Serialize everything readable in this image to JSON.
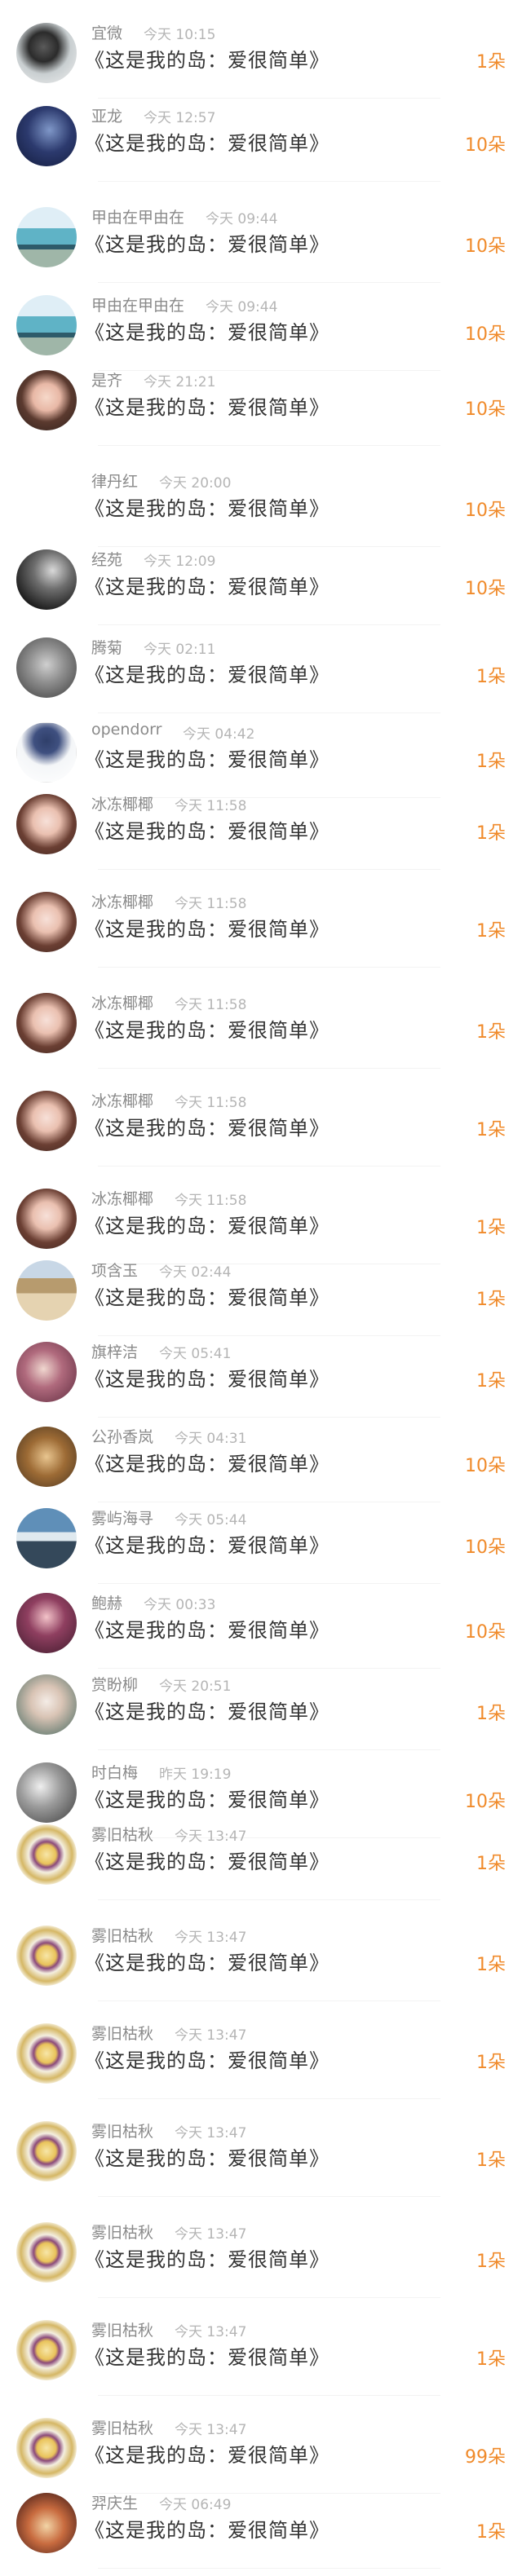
{
  "rows": [
    {
      "name": "宜微",
      "time": "今天 10:15",
      "title": "《这是我的岛：爱很简单》",
      "count": "1朵",
      "avatar": "av-ink"
    },
    {
      "name": "亚龙",
      "time": "今天 12:57",
      "title": "《这是我的岛：爱很简单》",
      "count": "10朵",
      "avatar": "av-blue"
    },
    {
      "name": "甲由在甲由在",
      "time": "今天 09:44",
      "title": "《这是我的岛：爱很简单》",
      "count": "10朵",
      "avatar": "av-van"
    },
    {
      "name": "甲由在甲由在",
      "time": "今天 09:44",
      "title": "《这是我的岛：爱很简单》",
      "count": "10朵",
      "avatar": "av-van"
    },
    {
      "name": "是齐",
      "time": "今天 21:21",
      "title": "《这是我的岛：爱很简单》",
      "count": "10朵",
      "avatar": "av-girl"
    },
    {
      "name": "律丹红",
      "time": "今天 20:00",
      "title": "《这是我的岛：爱很简单》",
      "count": "10朵",
      "avatar": ""
    },
    {
      "name": "经苑",
      "time": "今天 12:09",
      "title": "《这是我的岛：爱很简单》",
      "count": "10朵",
      "avatar": "av-dark"
    },
    {
      "name": "腾菊",
      "time": "今天 02:11",
      "title": "《这是我的岛：爱很简单》",
      "count": "1朵",
      "avatar": "av-gray"
    },
    {
      "name": "opendorr",
      "time": "今天 04:42",
      "title": "《这是我的岛：爱很简单》",
      "count": "1朵",
      "avatar": "av-sketch"
    },
    {
      "name": "冰冻椰椰",
      "time": "今天 11:58",
      "title": "《这是我的岛：爱很简单》",
      "count": "1朵",
      "avatar": "av-pink"
    },
    {
      "name": "冰冻椰椰",
      "time": "今天 11:58",
      "title": "《这是我的岛：爱很简单》",
      "count": "1朵",
      "avatar": "av-pink"
    },
    {
      "name": "冰冻椰椰",
      "time": "今天 11:58",
      "title": "《这是我的岛：爱很简单》",
      "count": "1朵",
      "avatar": "av-pink"
    },
    {
      "name": "冰冻椰椰",
      "time": "今天 11:58",
      "title": "《这是我的岛：爱很简单》",
      "count": "1朵",
      "avatar": "av-pink"
    },
    {
      "name": "冰冻椰椰",
      "time": "今天 11:58",
      "title": "《这是我的岛：爱很简单》",
      "count": "1朵",
      "avatar": "av-pink"
    },
    {
      "name": "项含玉",
      "time": "今天 02:44",
      "title": "《这是我的岛：爱很简单》",
      "count": "1朵",
      "avatar": "av-hat"
    },
    {
      "name": "旗梓洁",
      "time": "今天 05:41",
      "title": "《这是我的岛：爱很简单》",
      "count": "1朵",
      "avatar": "av-mauve"
    },
    {
      "name": "公孙香岚",
      "time": "今天 04:31",
      "title": "《这是我的岛：爱很简单》",
      "count": "10朵",
      "avatar": "av-sepia"
    },
    {
      "name": "雾屿海寻",
      "time": "今天 05:44",
      "title": "《这是我的岛：爱很简单》",
      "count": "10朵",
      "avatar": "av-sea"
    },
    {
      "name": "鲍赫",
      "time": "今天 00:33",
      "title": "《这是我的岛：爱很简单》",
      "count": "10朵",
      "avatar": "av-purple"
    },
    {
      "name": "赏盼柳",
      "time": "今天 20:51",
      "title": "《这是我的岛：爱很简单》",
      "count": "1朵",
      "avatar": "av-soft"
    },
    {
      "name": "时白梅",
      "time": "昨天 19:19",
      "title": "《这是我的岛：爱很简单》",
      "count": "10朵",
      "avatar": "av-bw"
    },
    {
      "name": "雾旧枯秋",
      "time": "今天 13:47",
      "title": "《这是我的岛：爱很简单》",
      "count": "1朵",
      "avatar": "av-gold"
    },
    {
      "name": "雾旧枯秋",
      "time": "今天 13:47",
      "title": "《这是我的岛：爱很简单》",
      "count": "1朵",
      "avatar": "av-gold"
    },
    {
      "name": "雾旧枯秋",
      "time": "今天 13:47",
      "title": "《这是我的岛：爱很简单》",
      "count": "1朵",
      "avatar": "av-gold"
    },
    {
      "name": "雾旧枯秋",
      "time": "今天 13:47",
      "title": "《这是我的岛：爱很简单》",
      "count": "1朵",
      "avatar": "av-gold"
    },
    {
      "name": "雾旧枯秋",
      "time": "今天 13:47",
      "title": "《这是我的岛：爱很简单》",
      "count": "1朵",
      "avatar": "av-gold"
    },
    {
      "name": "雾旧枯秋",
      "time": "今天 13:47",
      "title": "《这是我的岛：爱很简单》",
      "count": "1朵",
      "avatar": "av-gold"
    },
    {
      "name": "雾旧枯秋",
      "time": "今天 13:47",
      "title": "《这是我的岛：爱很简单》",
      "count": "99朵",
      "avatar": "av-gold"
    },
    {
      "name": "羿庆生",
      "time": "今天 06:49",
      "title": "《这是我的岛：爱很简单》",
      "count": "1朵",
      "avatar": "av-food"
    }
  ],
  "colors": {
    "count": "#f08a2a",
    "name": "#8a8a8a",
    "time": "#b5b5b5",
    "title": "#333333"
  }
}
